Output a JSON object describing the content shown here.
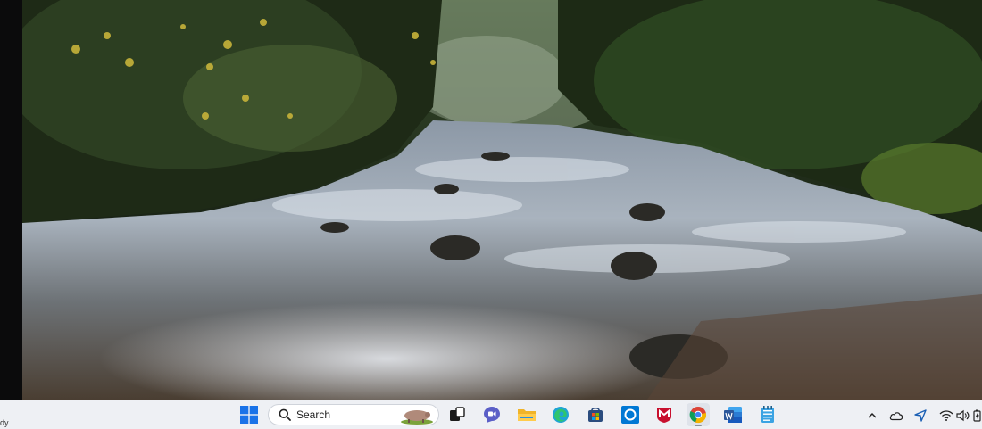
{
  "status": {
    "text": "dy"
  },
  "taskbar": {
    "search": {
      "label": "Search"
    },
    "apps": [
      {
        "name": "start",
        "icon": "windows-logo-icon"
      },
      {
        "name": "task-view",
        "icon": "task-view-icon"
      },
      {
        "name": "teams-chat",
        "icon": "chat-icon"
      },
      {
        "name": "file-explorer",
        "icon": "folder-icon"
      },
      {
        "name": "edge",
        "icon": "edge-icon"
      },
      {
        "name": "store",
        "icon": "store-icon"
      },
      {
        "name": "cortana",
        "icon": "cortana-icon"
      },
      {
        "name": "mcafee",
        "icon": "mcafee-icon"
      },
      {
        "name": "chrome",
        "icon": "chrome-icon",
        "active": true
      },
      {
        "name": "word",
        "icon": "word-icon"
      },
      {
        "name": "notepad",
        "icon": "notepad-icon"
      }
    ],
    "tray": [
      "chevron-up-icon",
      "onedrive-icon",
      "location-icon",
      "wifi-icon",
      "volume-icon",
      "battery-icon"
    ]
  },
  "colors": {
    "taskbar_bg": "#eef0f4",
    "windows_blue": "#1a73e8",
    "mcafee_red": "#c8102e",
    "word_blue": "#2b579a"
  }
}
